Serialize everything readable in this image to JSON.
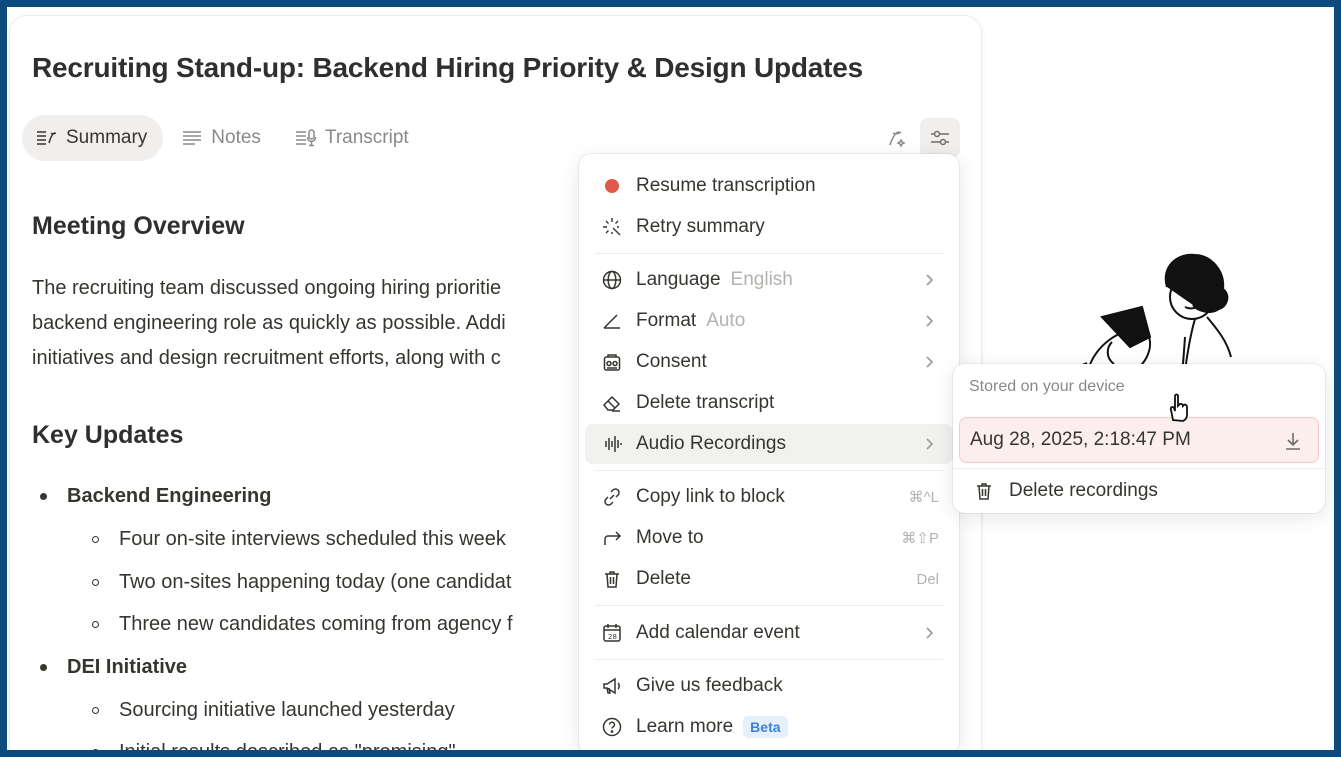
{
  "doc": {
    "title": "Recruiting Stand-up: Backend Hiring Priority & Design Updates",
    "tabs": [
      {
        "label": "Summary",
        "icon": "summary-icon",
        "active": true
      },
      {
        "label": "Notes",
        "icon": "notes-icon",
        "active": false
      },
      {
        "label": "Transcript",
        "icon": "transcript-icon",
        "active": false
      }
    ],
    "overview_heading": "Meeting Overview",
    "overview_lines": [
      "The recruiting team discussed ongoing hiring prioritie",
      "backend engineering role as quickly as possible. Addi",
      "initiatives and design recruitment efforts, along with c"
    ],
    "updates_heading": "Key Updates",
    "bullets": [
      {
        "text": "Backend Engineering",
        "children": [
          "Four on-site interviews scheduled this week",
          "Two on-sites happening today (one candidat",
          "Three new candidates coming from agency f"
        ]
      },
      {
        "text": "DEI Initiative",
        "children": [
          "Sourcing initiative launched yesterday",
          "Initial results described as \"promising\""
        ]
      }
    ]
  },
  "menu": {
    "resume": "Resume transcription",
    "retry": "Retry summary",
    "language": "Language",
    "language_value": "English",
    "format": "Format",
    "format_value": "Auto",
    "consent": "Consent",
    "delete_transcript": "Delete transcript",
    "audio_recordings": "Audio Recordings",
    "copy_link": "Copy link to block",
    "copy_link_kbd": "⌘^L",
    "move_to": "Move to",
    "move_to_kbd": "⌘⇧P",
    "delete": "Delete",
    "delete_kbd": "Del",
    "calendar": "Add calendar event",
    "feedback": "Give us feedback",
    "learn_more": "Learn more",
    "beta": "Beta"
  },
  "submenu": {
    "header": "Stored on your device",
    "recording": "Aug 28, 2025, 2:18:47 PM",
    "delete_recordings": "Delete recordings"
  },
  "colors": {
    "frame_border": "#0d4a7e",
    "record_dot": "#e05a4b",
    "beta_text": "#3a82d6",
    "selected_recording_bg": "#fbeeec"
  }
}
